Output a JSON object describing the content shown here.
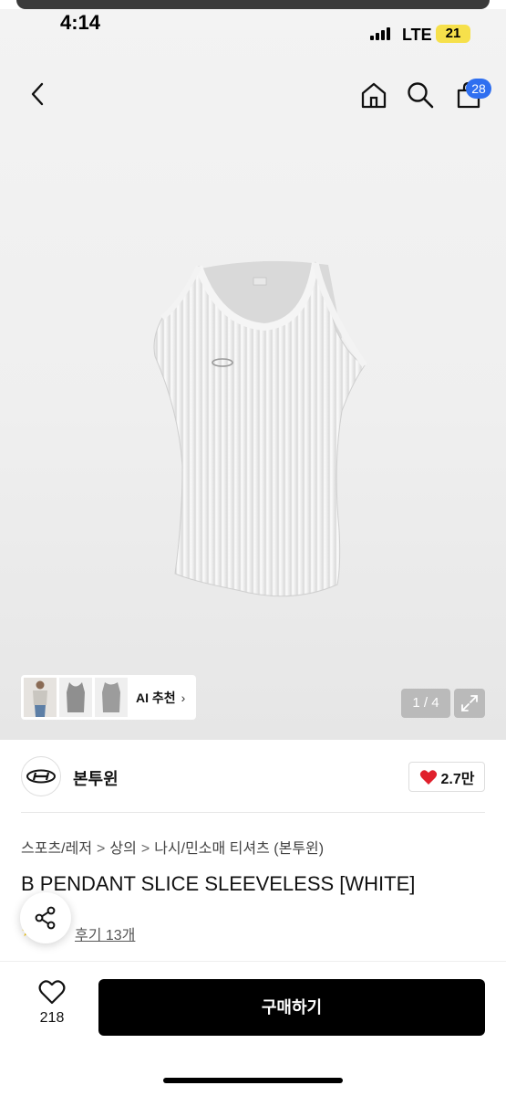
{
  "status": {
    "time": "4:14",
    "carrier": "LTE",
    "battery": "21"
  },
  "nav": {
    "cart_count": "28"
  },
  "gallery": {
    "ai_label": "AI 추천",
    "pager": "1 / 4"
  },
  "brand": {
    "name": "본투윈",
    "likes": "2.7만"
  },
  "breadcrumb": [
    "스포츠/레저",
    "상의",
    "나시/민소매 티셔츠 (본투윈)"
  ],
  "product": {
    "title": "B PENDANT SLICE SLEEVELESS [WHITE]",
    "reviews": "후기 13개"
  },
  "bottom": {
    "wish_count": "218",
    "buy_label": "구매하기"
  },
  "colors": {
    "accent_badge": "#2f6ff0",
    "buy_button": "#000000",
    "heart": "#e0202c"
  }
}
